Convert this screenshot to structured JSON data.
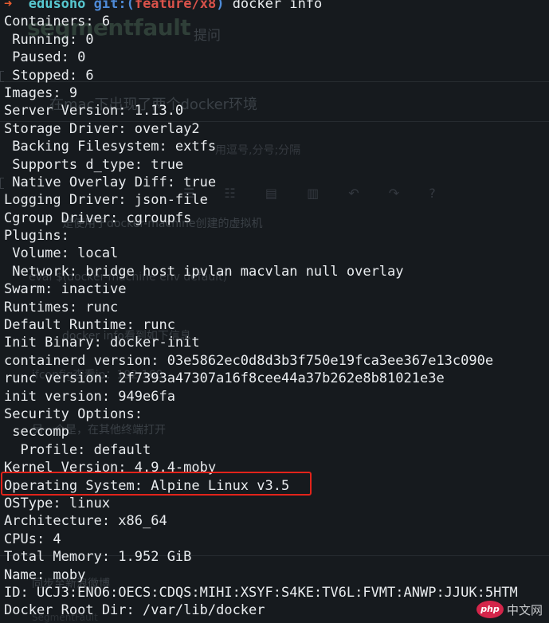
{
  "prompt": {
    "arrow": "➜",
    "directory": "edusoho",
    "git_label": "git:(",
    "branch": "feature/x8",
    "git_close": ")",
    "command": "docker info"
  },
  "output_lines": [
    "Containers: 6",
    " Running: 0",
    " Paused: 0",
    " Stopped: 6",
    "Images: 9",
    "Server Version: 1.13.0",
    "Storage Driver: overlay2",
    " Backing Filesystem: extfs",
    " Supports d_type: true",
    " Native Overlay Diff: true",
    "Logging Driver: json-file",
    "Cgroup Driver: cgroupfs",
    "Plugins:",
    " Volume: local",
    " Network: bridge host ipvlan macvlan null overlay",
    "Swarm: inactive",
    "Runtimes: runc",
    "Default Runtime: runc",
    "Init Binary: docker-init",
    "containerd version: 03e5862ec0d8d3b3f750e19fca3ee367e13c090e",
    "runc version: 2f7393a47307a16f8cee44a37b262e8b81021e3e",
    "init version: 949e6fa",
    "Security Options:",
    " seccomp",
    "  Profile: default",
    "Kernel Version: 4.9.4-moby",
    "Operating System: Alpine Linux v3.5",
    "OSType: linux",
    "Architecture: x86_64",
    "CPUs: 4",
    "Total Memory: 1.952 GiB",
    "Name: moby",
    "ID: UCJ3:ENO6:OECS:CDQS:MIHI:XSYF:S4KE:TV6L:FVMT:ANWP:JJUK:5HTM",
    "Docker Root Dir: /var/lib/docker"
  ],
  "highlighted_line_index": 26,
  "background_page": {
    "logo": "segmentfault",
    "ask_link": "提问",
    "question_title": "在mac下出现了两个docker环境",
    "tags_hint": "用逗号,分号;分隔",
    "toolbar": "☰ ☷ ▤ ▥ ↶ ↷ ?",
    "line1": "是使用于docker-machine创建的虚拟机",
    "line2": "eval $(docker-machine env default)",
    "line3": "docker info看到如下信息",
    "line4": "ifconfig查看ip：192.168",
    "line5": "另一个是，在其他终端打开",
    "line6": "同步至新浪微博",
    "line7": "SegmentFault"
  },
  "watermark": {
    "logo_text": "php",
    "text": "中文网"
  },
  "colors": {
    "terminal_bg": "#161a1e",
    "text": "#e9ecef",
    "prompt_arrow": "#e85c2f",
    "prompt_dir": "#57c7cf",
    "prompt_git": "#4e8bd8",
    "prompt_branch": "#d9524a",
    "highlight_border": "#e2231a"
  }
}
